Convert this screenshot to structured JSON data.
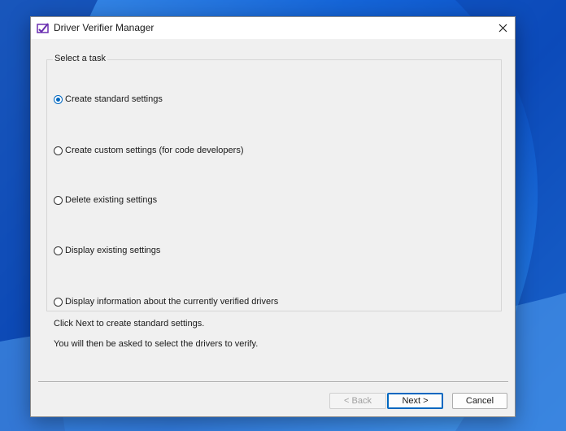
{
  "window": {
    "title": "Driver Verifier Manager"
  },
  "task_group": {
    "label": "Select a task",
    "options": [
      {
        "label": "Create standard settings",
        "checked": true
      },
      {
        "label": "Create custom settings (for code developers)",
        "checked": false
      },
      {
        "label": "Delete existing settings",
        "checked": false
      },
      {
        "label": "Display existing settings",
        "checked": false
      },
      {
        "label": "Display information about the currently verified drivers",
        "checked": false
      }
    ]
  },
  "info": {
    "line1": "Click Next to create standard settings.",
    "line2": "You will then be asked to select the drivers to verify."
  },
  "buttons": {
    "back": "< Back",
    "next": "Next >",
    "cancel": "Cancel"
  },
  "colors": {
    "accent": "#0067c0",
    "dialog_bg": "#f0f0f0",
    "wallpaper": "#1565d8"
  }
}
